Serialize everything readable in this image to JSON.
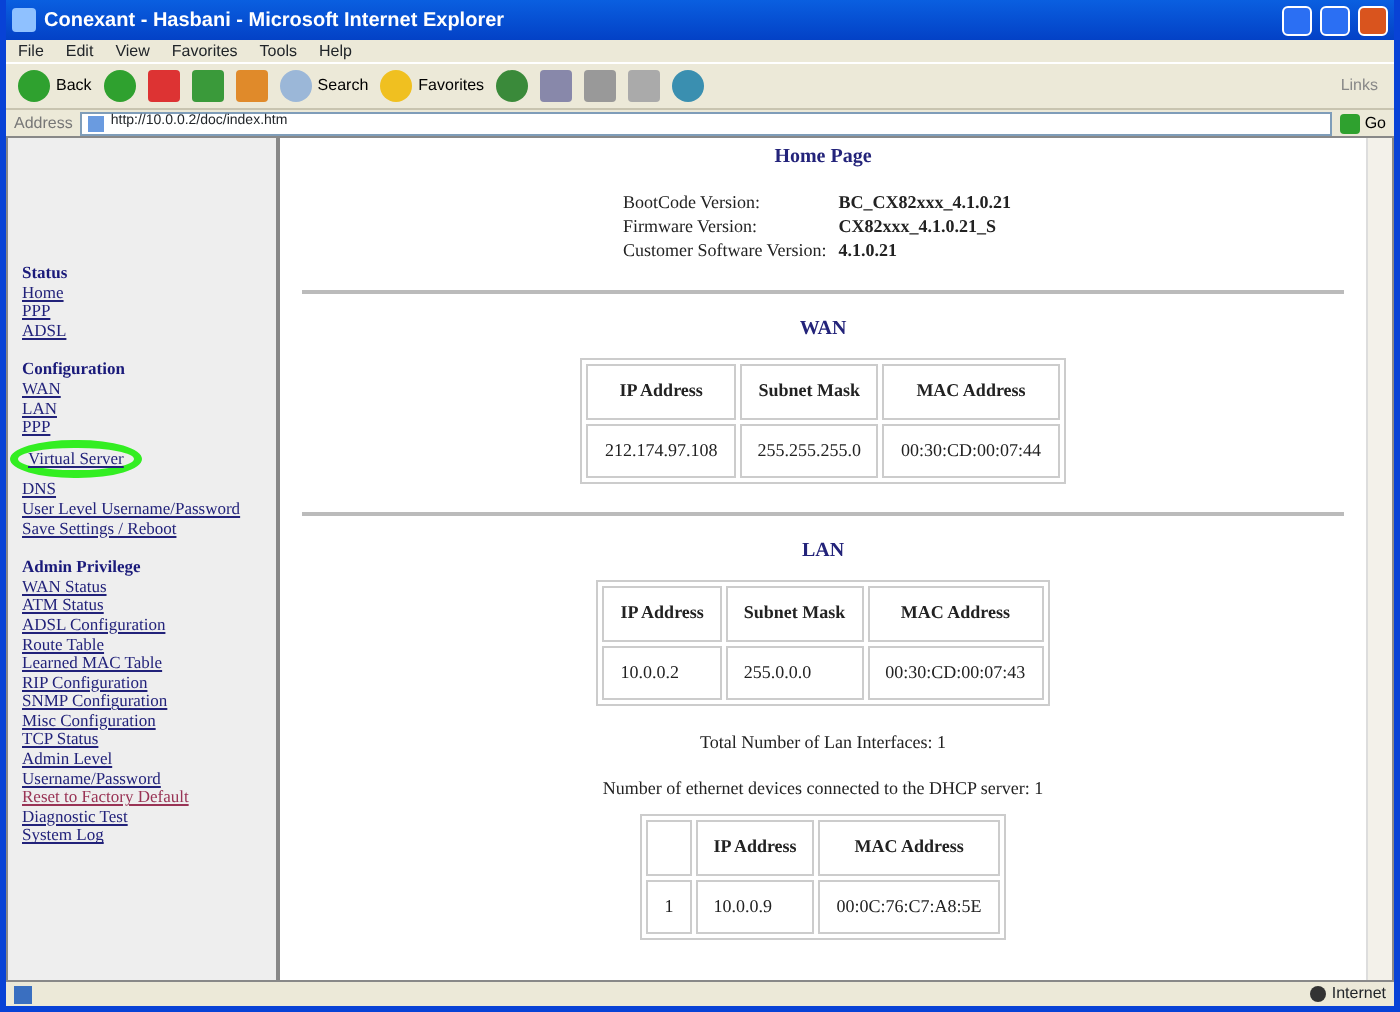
{
  "window": {
    "title": "Conexant - Hasbani - Microsoft Internet Explorer"
  },
  "menu_bar": [
    "File",
    "Edit",
    "View",
    "Favorites",
    "Tools",
    "Help"
  ],
  "toolbar": {
    "back": "Back",
    "search": "Search",
    "favorites": "Favorites",
    "links": "Links"
  },
  "address_bar": {
    "label": "Address",
    "url": "http://10.0.0.2/doc/index.htm",
    "go": "Go"
  },
  "sidebar": {
    "sections": [
      {
        "heading": "Status",
        "items": [
          {
            "label": "Home",
            "circled": false,
            "visited": false
          },
          {
            "label": "PPP",
            "circled": false,
            "visited": false
          },
          {
            "label": "ADSL",
            "circled": false,
            "visited": false
          }
        ]
      },
      {
        "heading": "Configuration",
        "items": [
          {
            "label": "WAN",
            "circled": false,
            "visited": false
          },
          {
            "label": "LAN",
            "circled": false,
            "visited": false
          },
          {
            "label": "PPP",
            "circled": false,
            "visited": false
          },
          {
            "label": "Virtual Server",
            "circled": true,
            "visited": false
          },
          {
            "label": "DNS",
            "circled": false,
            "visited": false
          },
          {
            "label": "User Level Username/Password",
            "circled": false,
            "visited": false
          },
          {
            "label": "Save Settings / Reboot",
            "circled": false,
            "visited": false
          }
        ]
      },
      {
        "heading": "Admin Privilege",
        "items": [
          {
            "label": "WAN Status",
            "circled": false,
            "visited": false
          },
          {
            "label": "ATM Status",
            "circled": false,
            "visited": false
          },
          {
            "label": "ADSL Configuration",
            "circled": false,
            "visited": false
          },
          {
            "label": "Route Table",
            "circled": false,
            "visited": false
          },
          {
            "label": "Learned MAC Table",
            "circled": false,
            "visited": false
          },
          {
            "label": "RIP Configuration",
            "circled": false,
            "visited": false
          },
          {
            "label": "SNMP Configuration",
            "circled": false,
            "visited": false
          },
          {
            "label": "Misc Configuration",
            "circled": false,
            "visited": false
          },
          {
            "label": "TCP Status",
            "circled": false,
            "visited": false
          },
          {
            "label": "Admin Level",
            "circled": false,
            "visited": false
          },
          {
            "label": "Username/Password",
            "circled": false,
            "visited": false
          },
          {
            "label": "Reset to Factory Default",
            "circled": false,
            "visited": true
          },
          {
            "label": "Diagnostic Test",
            "circled": false,
            "visited": false
          },
          {
            "label": "System Log",
            "circled": false,
            "visited": false
          }
        ]
      }
    ]
  },
  "main": {
    "title": "Home Page",
    "versions": [
      {
        "label": "BootCode Version:",
        "value": "BC_CX82xxx_4.1.0.21"
      },
      {
        "label": "Firmware Version:",
        "value": "CX82xxx_4.1.0.21_S"
      },
      {
        "label": "Customer Software Version:",
        "value": "4.1.0.21"
      }
    ],
    "wan": {
      "title": "WAN",
      "columns": [
        "IP Address",
        "Subnet Mask",
        "MAC Address"
      ],
      "rows": [
        [
          "212.174.97.108",
          "255.255.255.0",
          "00:30:CD:00:07:44"
        ]
      ]
    },
    "lan": {
      "title": "LAN",
      "columns": [
        "IP Address",
        "Subnet Mask",
        "MAC Address"
      ],
      "rows": [
        [
          "10.0.0.2",
          "255.0.0.0",
          "00:30:CD:00:07:43"
        ]
      ]
    },
    "lan_interfaces": "Total Number of Lan Interfaces: 1",
    "dhcp_devices": "Number of ethernet devices connected to the DHCP server: 1",
    "dhcp_table": {
      "columns": [
        "",
        "IP Address",
        "MAC Address"
      ],
      "rows": [
        [
          "1",
          "10.0.0.9",
          "00:0C:76:C7:A8:5E"
        ]
      ]
    }
  },
  "status_bar": {
    "zone": "Internet"
  }
}
